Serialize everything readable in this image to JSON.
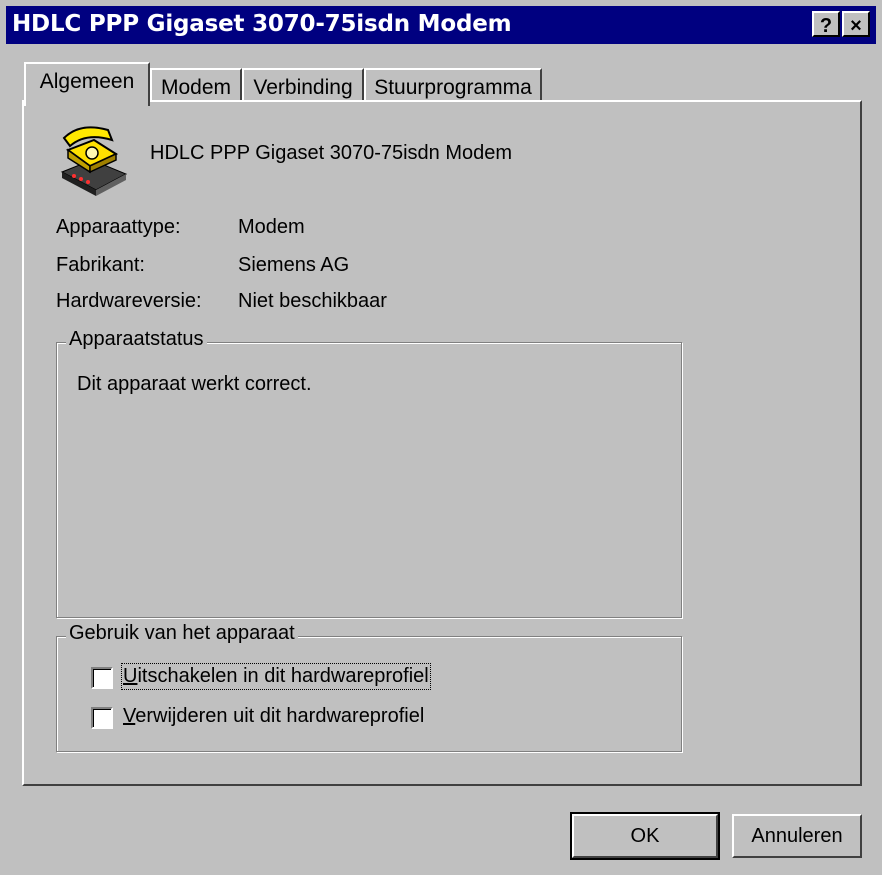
{
  "window": {
    "title": "HDLC PPP Gigaset 3070-75isdn Modem",
    "help_btn": "?",
    "close_btn": "×"
  },
  "tabs": [
    {
      "label": "Algemeen",
      "active": true
    },
    {
      "label": "Modem",
      "active": false
    },
    {
      "label": "Verbinding",
      "active": false
    },
    {
      "label": "Stuurprogramma",
      "active": false
    }
  ],
  "device": {
    "icon": "modem-phone-icon",
    "name": "HDLC PPP Gigaset 3070-75isdn Modem",
    "props": [
      {
        "label": "Apparaattype:",
        "value": "Modem"
      },
      {
        "label": "Fabrikant:",
        "value": "Siemens AG"
      },
      {
        "label": "Hardwareversie:",
        "value": "Niet beschikbaar"
      }
    ]
  },
  "status": {
    "title": "Apparaatstatus",
    "text": "Dit apparaat werkt correct."
  },
  "usage": {
    "title": "Gebruik van het apparaat",
    "options": [
      {
        "accel": "U",
        "rest": "itschakelen in dit hardwareprofiel",
        "checked": false
      },
      {
        "accel": "V",
        "rest": "erwijderen uit dit hardwareprofiel",
        "checked": false
      }
    ]
  },
  "buttons": {
    "ok": "OK",
    "cancel": "Annuleren"
  }
}
